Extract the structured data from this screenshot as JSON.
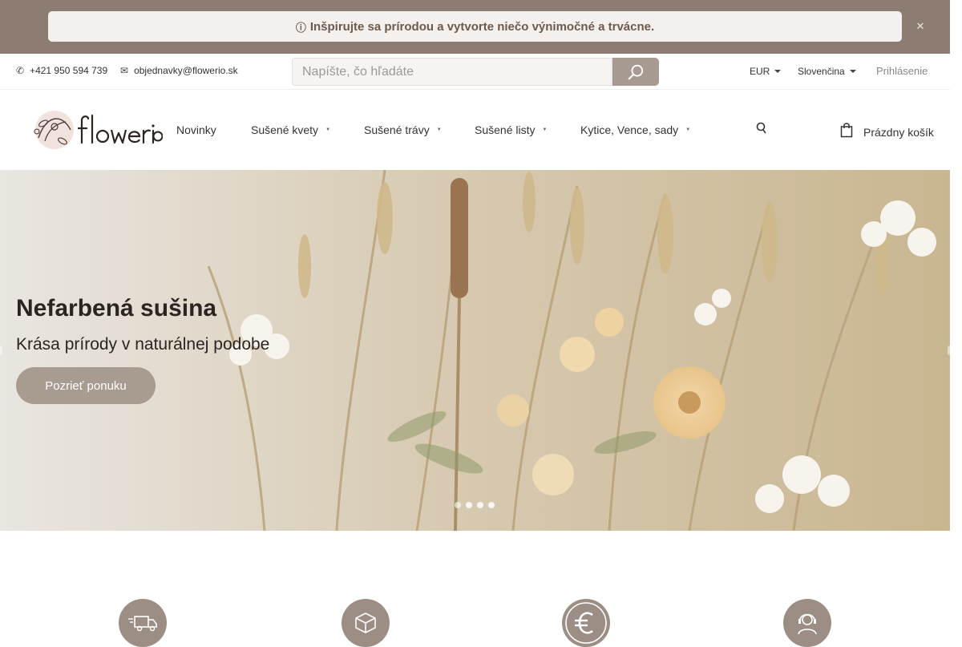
{
  "announcement": {
    "icon": "info-icon",
    "text": "Inšpirujte sa prírodou a vytvorte niečo výnimočné a trvácne.",
    "close_icon": "close-icon"
  },
  "topbar": {
    "phone": "+421 950 594 739",
    "email": "objednavky@flowerio.sk",
    "search_placeholder": "Napíšte, čo hľadáte",
    "search_value": "",
    "currency": "EUR",
    "language": "Slovenčina",
    "login": "Prihlásenie"
  },
  "header": {
    "logo_text": "flowerio",
    "nav": [
      {
        "label": "Novinky",
        "has_dropdown": false
      },
      {
        "label": "Sušené kvety",
        "has_dropdown": true
      },
      {
        "label": "Sušené trávy",
        "has_dropdown": true
      },
      {
        "label": "Sušené listy",
        "has_dropdown": true
      },
      {
        "label": "Kytice, Vence, sady",
        "has_dropdown": true
      }
    ],
    "cart_label": "Prázdny košík"
  },
  "hero": {
    "title": "Nefarbená sušina",
    "subtitle": "Krása prírody v naturálnej podobe",
    "button": "Pozrieť ponuku",
    "slides_count": 4,
    "active_slide": 1
  },
  "benefits": [
    {
      "icon": "delivery-truck-icon"
    },
    {
      "icon": "package-box-icon"
    },
    {
      "icon": "euro-icon"
    },
    {
      "icon": "customer-support-icon"
    }
  ],
  "colors": {
    "announcement_bg": "#8c7c72",
    "accent": "#a89b90",
    "announcement_text": "#6d5a4d"
  }
}
